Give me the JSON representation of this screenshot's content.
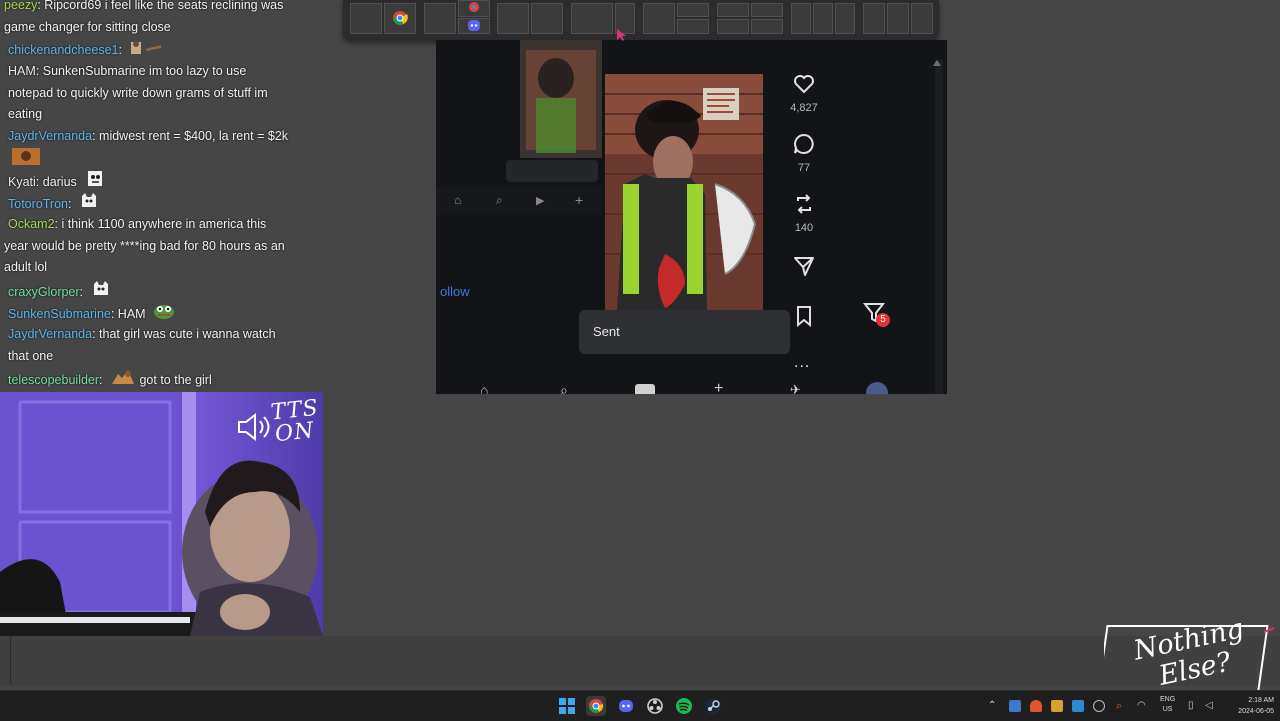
{
  "chat": {
    "messages": [
      {
        "user": "peezy",
        "user_color": "#a3d95a",
        "text": ": Ripcord69 i feel like the seats reclining was game changer for sitting close"
      },
      {
        "user": "chickenandcheese1",
        "user_color": "#5fb4e8",
        "text": ":"
      },
      {
        "user": "HAM",
        "user_color": "#e8e8e8",
        "text": ": SunkenSubmarine im too lazy to use notepad to quickly write down grams of stuff im eating"
      },
      {
        "user": "JaydrVernanda",
        "user_color": "#5fb4e8",
        "text": ": midwest rent = $400, la rent = $2k"
      },
      {
        "user": "Kyati",
        "user_color": "#e8e8e8",
        "text": ": darius"
      },
      {
        "user": "TotoroTron",
        "user_color": "#5fb4e8",
        "text": ":"
      },
      {
        "user": "Ockam2",
        "user_color": "#a3d95a",
        "text": ": i think 1100 anywhere in america this year would be pretty ****ing bad for 80 hours as an adult lol"
      },
      {
        "user": "craxyGlorper",
        "user_color": "#6fe0a0",
        "text": ":"
      },
      {
        "user": "SunkenSubmarine",
        "user_color": "#5fb4e8",
        "text": ": HAM"
      },
      {
        "user": "JaydrVernanda",
        "user_color": "#5fb4e8",
        "text": ": that girl was cute i wanna watch that one"
      },
      {
        "user": "telescopebuilder",
        "user_color": "#6fe0a0",
        "text": ": got to the girl"
      }
    ]
  },
  "webcam": {
    "tts_label": "TTS\nON",
    "tts_line1": "TTS",
    "tts_line2": "ON"
  },
  "browser": {
    "follow_text": "ollow",
    "side_actions": [
      {
        "icon": "heart-icon",
        "count": "4,827"
      },
      {
        "icon": "comment-icon",
        "count": "77"
      },
      {
        "icon": "repost-icon",
        "count": "140"
      },
      {
        "icon": "send-icon",
        "count": ""
      },
      {
        "icon": "bookmark-icon",
        "count": ""
      }
    ],
    "notification_count": "5",
    "sent_label": "Sent",
    "more_label": "..."
  },
  "overlay": {
    "logo_text": "Nothing Else?"
  },
  "taskbar": {
    "lang_top": "ENG",
    "lang_bottom": "US",
    "time": "2:18 AM",
    "date": "2024-06-05"
  }
}
